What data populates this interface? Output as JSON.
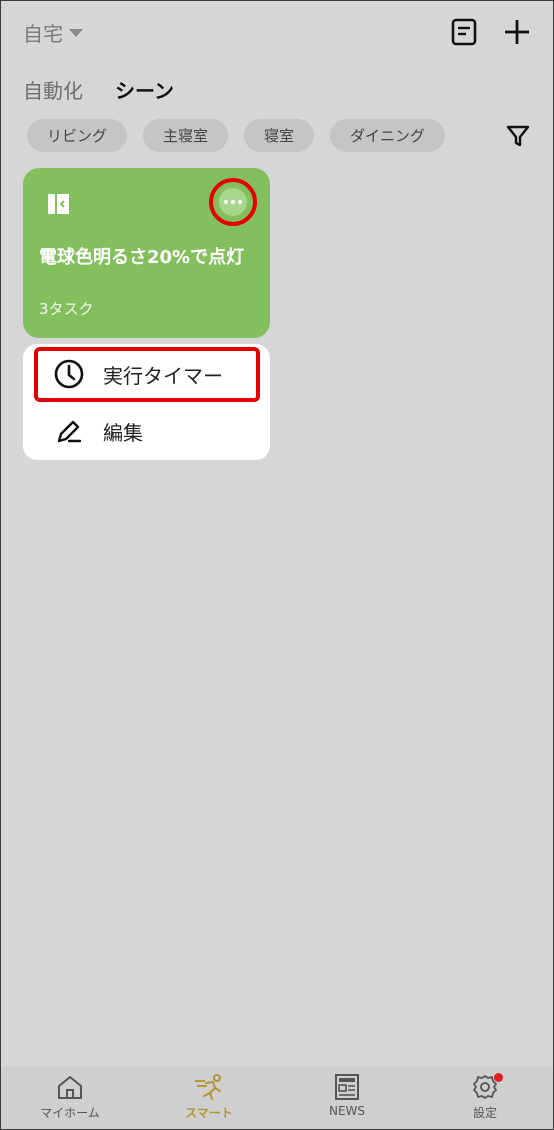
{
  "header": {
    "home_label": "自宅",
    "log_icon": "log-icon",
    "add_icon": "plus-icon"
  },
  "tabs": [
    {
      "label": "自動化",
      "active": false
    },
    {
      "label": "シーン",
      "active": true
    }
  ],
  "rooms": [
    "リビング",
    "主寝室",
    "寝室",
    "ダイニング"
  ],
  "filter_icon": "filter-icon",
  "scene": {
    "title": "電球色明るさ20%で点灯",
    "subtitle": "3タスク",
    "icon": "scene-door-icon",
    "more_icon": "more-icon",
    "color": "#84bf5d"
  },
  "menu": {
    "timer_label": "実行タイマー",
    "edit_label": "編集"
  },
  "bottom_nav": [
    {
      "label": "マイホーム",
      "icon": "home-icon"
    },
    {
      "label": "スマート",
      "icon": "smart-icon",
      "active": true
    },
    {
      "label": "NEWS",
      "icon": "news-icon"
    },
    {
      "label": "設定",
      "icon": "settings-icon",
      "badge": true
    }
  ],
  "colors": {
    "accent": "#b3962f",
    "highlight": "#e40000"
  }
}
